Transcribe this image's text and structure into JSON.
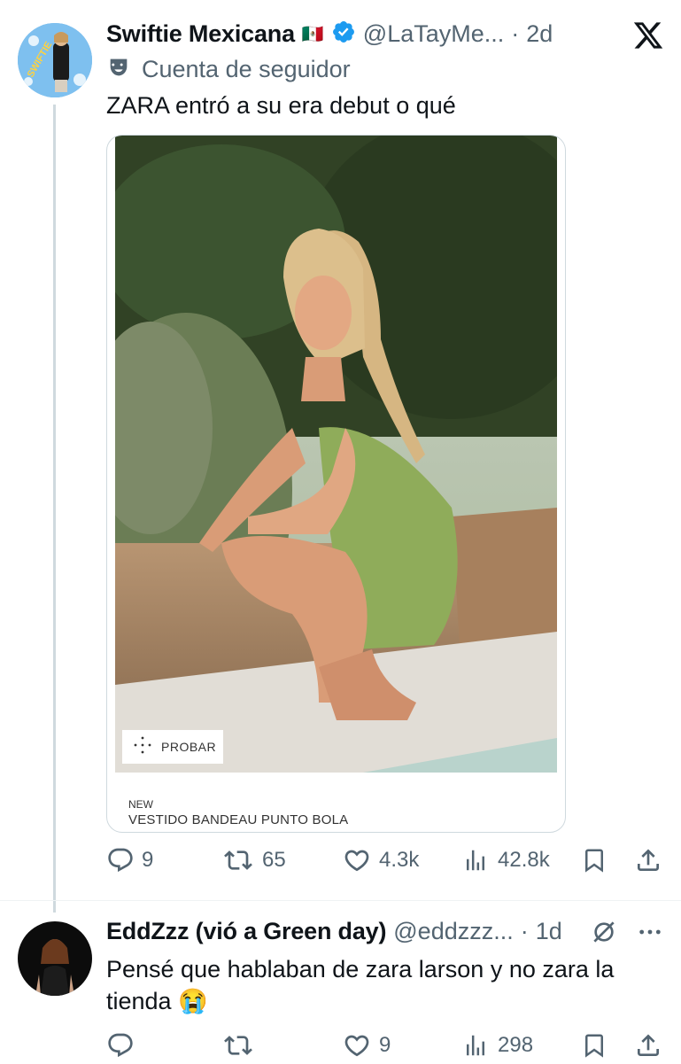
{
  "tweet": {
    "display_name": "Swiftie Mexicana",
    "flag": "🇲🇽",
    "handle": "@LaTayMe...",
    "dot": "·",
    "time": "2d",
    "badge_label": "Cuenta de seguidor",
    "text": "ZARA entró a su era debut o qué",
    "card": {
      "probar_label": "PROBAR",
      "tag": "NEW",
      "product": "VESTIDO BANDEAU PUNTO BOLA"
    },
    "actions": {
      "replies": "9",
      "retweets": "65",
      "likes": "4.3k",
      "views": "42.8k"
    }
  },
  "reply": {
    "display_name": "EddZzz (vió a Green day)",
    "handle": "@eddzzz...",
    "dot": "·",
    "time": "1d",
    "text_line1": "Pensé que hablaban de zara larson y no zara la",
    "text_line2": "tienda",
    "emoji": "😭",
    "actions": {
      "replies": "",
      "retweets": "",
      "likes": "9",
      "views": "298"
    }
  },
  "colors": {
    "verified": "#1d9bf0",
    "text": "#0f1419",
    "muted": "#536471",
    "dress": "#8fac5a"
  },
  "icons": [
    "x-logo-icon",
    "theater-mask-icon",
    "verified-badge-icon",
    "reply-icon",
    "retweet-icon",
    "like-icon",
    "views-icon",
    "bookmark-icon",
    "share-icon",
    "hidden-slash-icon",
    "more-icon"
  ]
}
